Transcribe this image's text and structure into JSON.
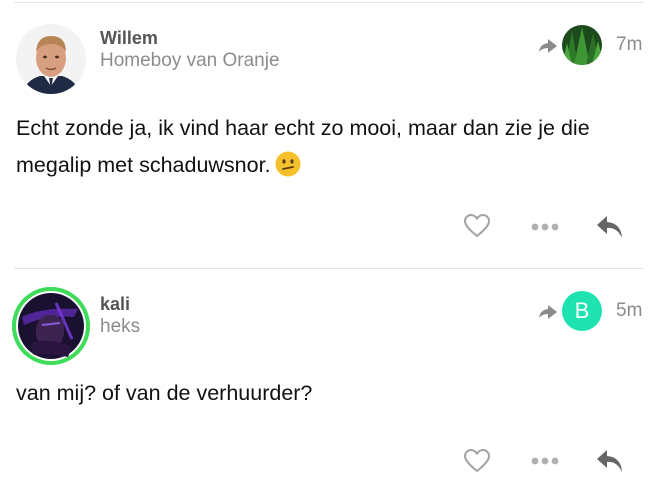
{
  "posts": [
    {
      "author": "Willem",
      "subtitle": "Homeboy van Oranje",
      "time": "7m",
      "text": "Echt zonde ja, ik vind haar echt zo mooi, maar dan zie je die megalip met schaduwsnor.",
      "emoji": "confused-face",
      "reply_to_avatar": "trees-image"
    },
    {
      "author": "kali",
      "subtitle": "heks",
      "time": "5m",
      "text": "van mij? of van de verhuurder?",
      "reply_to_letter": "B",
      "reply_to_color": "#1ee3b0",
      "avatar_ring_color": "#3fdc5a"
    }
  ],
  "icons": {
    "like": "heart-icon",
    "more": "ellipsis-icon",
    "reply": "reply-icon",
    "reply_to": "share-arrow-icon"
  }
}
